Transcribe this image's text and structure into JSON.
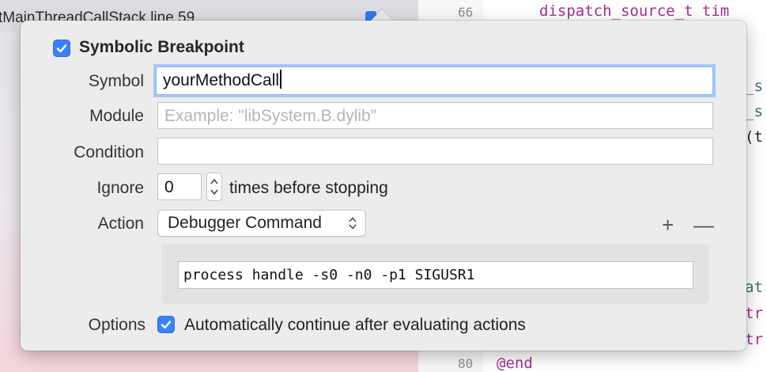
{
  "background": {
    "stack_text": "tMainThreadCallStack line 59",
    "line_numbers": [
      "66",
      "80"
    ],
    "code_fragments": [
      "dispatch_source_t tim",
      "_s",
      "_s",
      "(t",
      "at",
      "tr",
      "tr",
      "@end"
    ]
  },
  "popover": {
    "title": "Symbolic Breakpoint",
    "enabled": true,
    "symbol": {
      "label": "Symbol",
      "value": "yourMethodCall"
    },
    "module": {
      "label": "Module",
      "value": "",
      "placeholder": "Example: \"libSystem.B.dylib\""
    },
    "condition": {
      "label": "Condition",
      "value": ""
    },
    "ignore": {
      "label": "Ignore",
      "value": "0",
      "suffix": "times before stopping"
    },
    "action": {
      "label": "Action",
      "selected": "Debugger Command",
      "add": "+",
      "remove": "—"
    },
    "command": "process handle -s0 -n0 -p1 SIGUSR1",
    "options": {
      "label": "Options",
      "checked": true,
      "text": "Automatically continue after evaluating actions"
    }
  },
  "colors": {
    "accent": "#3b82f6",
    "keyword": "#a42f90",
    "popover_bg": "#ececec"
  }
}
